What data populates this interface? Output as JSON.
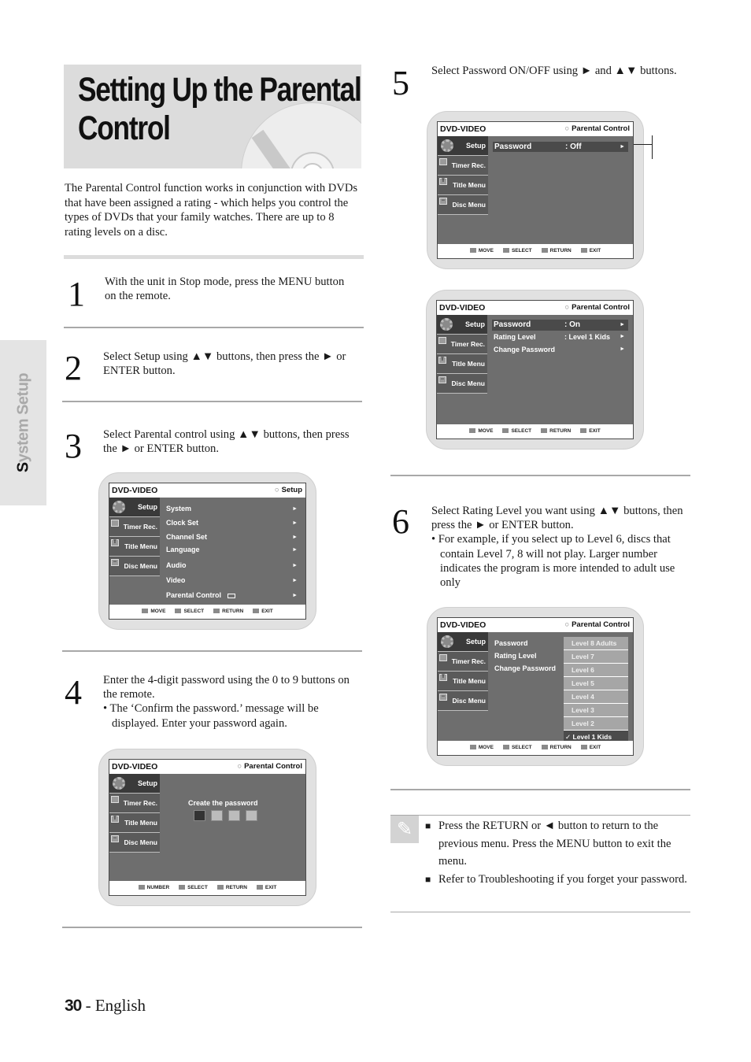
{
  "page": {
    "title": "Setting Up the Parental Control",
    "intro": "The Parental Control function works in conjunction with DVDs that have been assigned a rating - which helps you control the types of DVDs that your family watches. There are up to 8 rating levels on a disc.",
    "section_tab": {
      "first_letter": "S",
      "rest": "ystem Setup"
    },
    "footer": {
      "page_number": "30",
      "separator": " - ",
      "language": "English"
    }
  },
  "steps": [
    {
      "number": "1",
      "text": "With the unit in Stop mode, press the MENU button on the remote.",
      "bullets": []
    },
    {
      "number": "2",
      "text": "Select Setup using ▲▼ buttons, then press the ► or ENTER button.",
      "bullets": []
    },
    {
      "number": "3",
      "text": "Select Parental control using ▲▼ buttons, then press the ► or ENTER button.",
      "bullets": []
    },
    {
      "number": "4",
      "text": "Enter the 4-digit password using the 0 to 9 buttons on the remote.",
      "bullets": [
        "• The ‘Confirm the password.’ message will be displayed. Enter your password again."
      ]
    },
    {
      "number": "5",
      "text": "Select Password ON/OFF using ► and ▲▼ buttons.",
      "bullets": []
    },
    {
      "number": "6",
      "text": "Select Rating Level you want using ▲▼ buttons, then press the ► or ENTER button.",
      "bullets": [
        "• For example, if you select up to Level 6, discs that contain Level 7, 8 will not play. Larger number indicates the program is more intended to adult use only"
      ]
    }
  ],
  "osd_common": {
    "brand": "DVD-VIDEO",
    "sidebar": [
      "Setup",
      "Timer Rec.",
      "Title Menu",
      "Disc Menu"
    ],
    "footer": {
      "move": "MOVE",
      "number": "NUMBER",
      "select": "SELECT",
      "return": "RETURN",
      "exit": "EXIT"
    },
    "arrow": "►",
    "radio": "○"
  },
  "screens": {
    "setup": {
      "header": "Setup",
      "items": [
        "System",
        "Clock Set",
        "Channel Set",
        "Language",
        "Audio",
        "Video",
        "Parental Control"
      ]
    },
    "create_password": {
      "header": "Parental Control",
      "label": "Create the password",
      "digits_total": 4,
      "digits_entered": 0
    },
    "password_off": {
      "header": "Parental Control",
      "rows": [
        {
          "label": "Password",
          "value": ": Off"
        }
      ]
    },
    "password_on": {
      "header": "Parental Control",
      "rows": [
        {
          "label": "Password",
          "value": ": On"
        },
        {
          "label": "Rating Level",
          "value": ": Level 1 Kids"
        },
        {
          "label": "Change Password",
          "value": ""
        }
      ]
    },
    "rating_level": {
      "header": "Parental Control",
      "rows": [
        "Password",
        "Rating Level",
        "Change Password"
      ],
      "levels": [
        "Level 8 Adults",
        "Level 7",
        "Level 6",
        "Level 5",
        "Level 4",
        "Level 3",
        "Level 2",
        "Level 1 Kids"
      ],
      "selected_level": "Level 1 Kids",
      "check": "✓"
    }
  },
  "note": {
    "icon": "pencil-note-icon",
    "items": [
      "Press the RETURN or ◄ button to return to the previous menu. Press the MENU button to exit the menu.",
      "Refer to Troubleshooting if you forget your password."
    ]
  }
}
